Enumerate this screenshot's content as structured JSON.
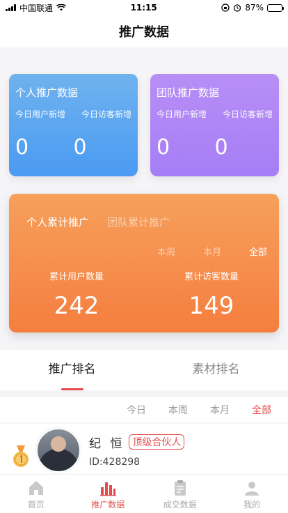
{
  "status_bar": {
    "carrier": "中国联通",
    "time": "11:15",
    "battery": "87%",
    "battery_level": 0.87
  },
  "nav": {
    "title": "推广数据"
  },
  "personal_card": {
    "title": "个人推广数据",
    "new_users_label": "今日用户新增",
    "new_visitors_label": "今日访客新增",
    "new_users": "0",
    "new_visitors": "0",
    "color": "#4b9bf3"
  },
  "team_card": {
    "title": "团队推广数据",
    "new_users_label": "今日用户新增",
    "new_visitors_label": "今日访客新增",
    "new_users": "0",
    "new_visitors": "0",
    "color": "#a57ef6"
  },
  "cumulative": {
    "tabs": [
      "个人累计推广",
      "团队累计推广"
    ],
    "periods": [
      "本周",
      "本月",
      "全部"
    ],
    "user_label": "累计用户数量",
    "visitor_label": "累计访客数量",
    "user_count": "242",
    "visitor_count": "149",
    "color": "#f57e3e"
  },
  "ranking": {
    "tabs": [
      "推广排名",
      "素材排名"
    ],
    "filters": [
      "今日",
      "本周",
      "本月",
      "全部"
    ],
    "items": [
      {
        "name": "纪 恒",
        "badge": "顶级合伙人",
        "id": "ID:428298"
      }
    ]
  },
  "tab_bar": [
    {
      "label": "首页",
      "icon": "home-icon"
    },
    {
      "label": "推广数据",
      "icon": "chart-icon"
    },
    {
      "label": "成交数据",
      "icon": "clipboard-icon"
    },
    {
      "label": "我的",
      "icon": "user-icon"
    }
  ],
  "accent_color": "#e64a4a"
}
